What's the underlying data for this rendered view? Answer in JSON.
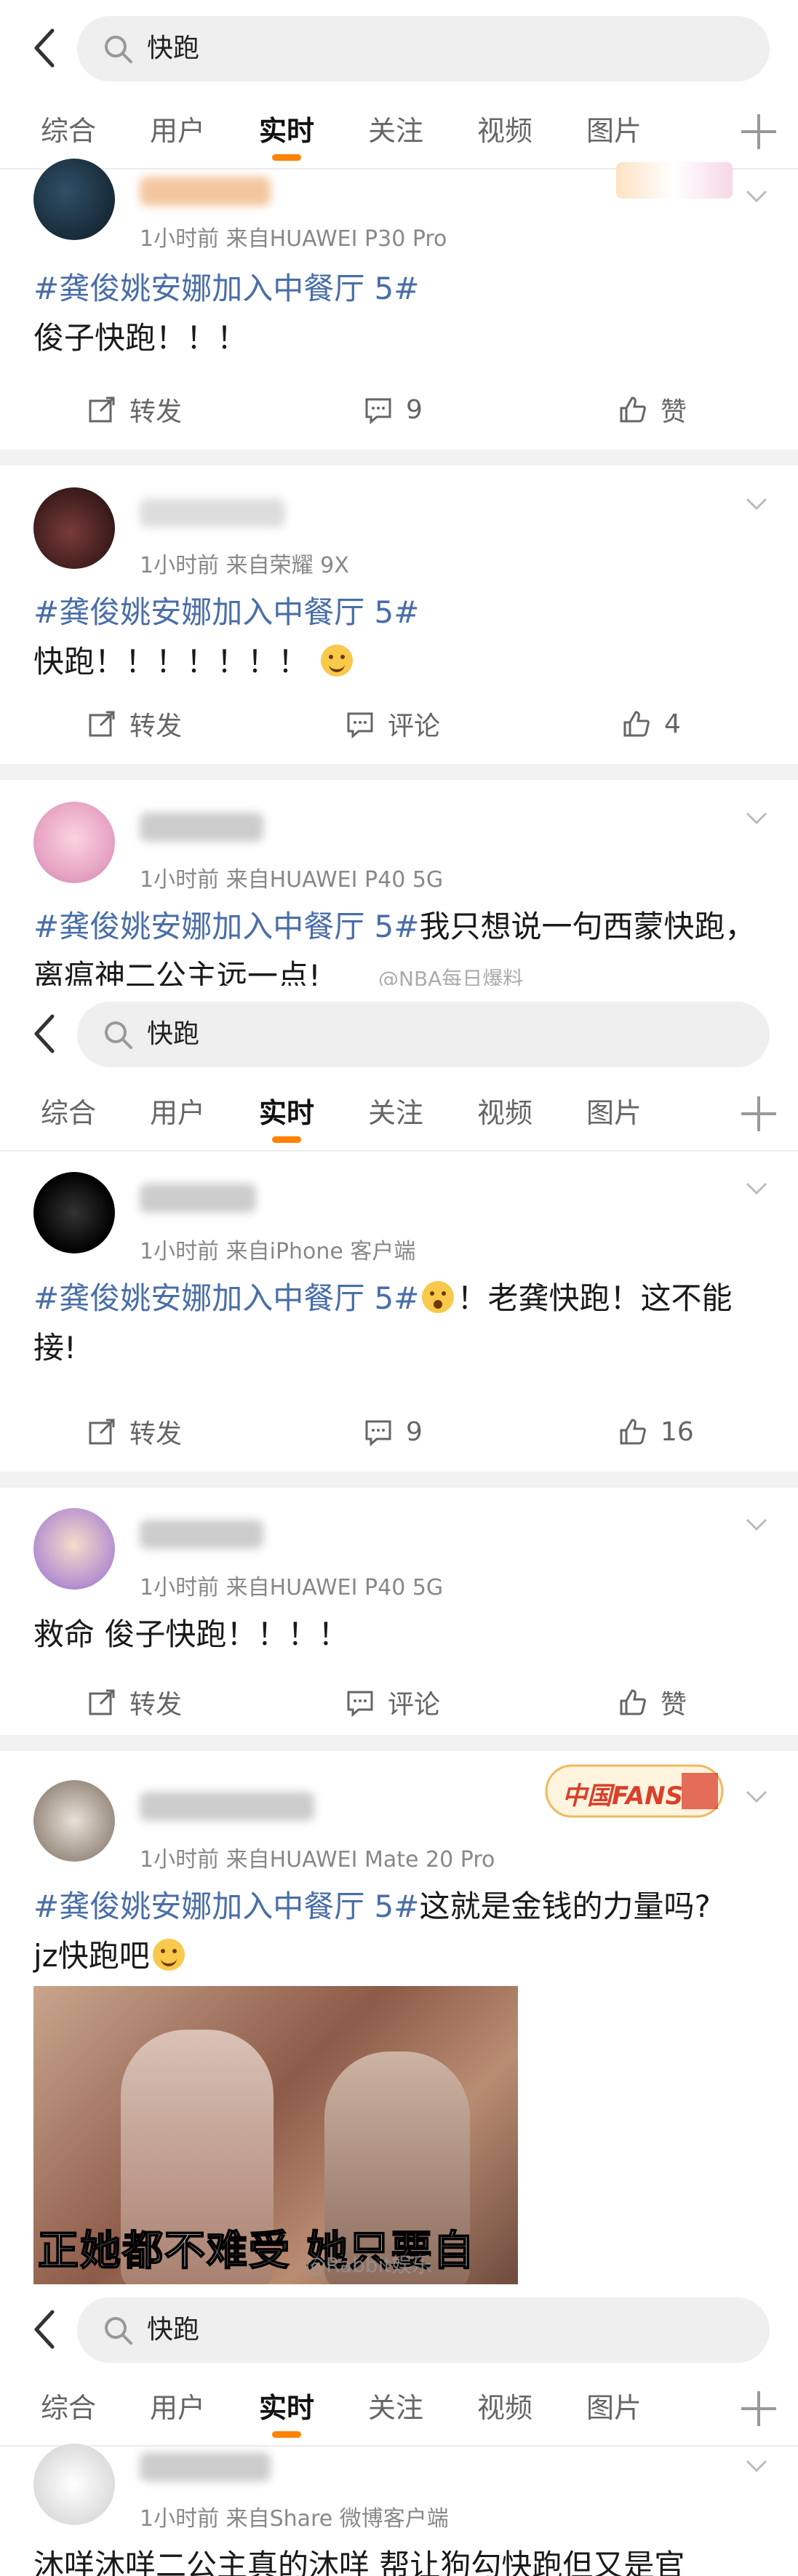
{
  "nav": {
    "query": "快跑",
    "tabs": [
      "综合",
      "用户",
      "实时",
      "关注",
      "视频",
      "图片"
    ],
    "active_tab": "实时"
  },
  "colors": {
    "accent": "#ff8200",
    "topic": "#4a6ea9",
    "meta": "#888888"
  },
  "screens": [
    {
      "posts": [
        {
          "meta": "1小时前  来自HUAWEI P30 Pro",
          "topic": "#龚俊姚安娜加入中餐厅 5#",
          "text": "俊子快跑！！！",
          "repost": "转发",
          "comment": "9",
          "like": "赞"
        },
        {
          "meta": "1小时前  来自荣耀 9X",
          "topic": "#龚俊姚安娜加入中餐厅 5#",
          "text": "快跑！！！！！！！",
          "repost": "转发",
          "comment": "评论",
          "like": "4"
        },
        {
          "meta": "1小时前  来自HUAWEI P40 5G",
          "topic": "#龚俊姚安娜加入中餐厅 5#",
          "text": "我只想说一句西蒙快跑，离瘟神二公主远一点!",
          "watermark": "@NBA每日爆料"
        }
      ]
    },
    {
      "posts": [
        {
          "meta": "1小时前  来自iPhone 客户端",
          "topic": "#龚俊姚安娜加入中餐厅 5#",
          "text_after_emoji": "！老龚快跑！这不能接!",
          "repost": "转发",
          "comment": "9",
          "like": "16"
        },
        {
          "meta": "1小时前  来自HUAWEI P40 5G",
          "text": "救命 俊子快跑！！！！",
          "repost": "转发",
          "comment": "评论",
          "like": "赞"
        },
        {
          "meta": "1小时前  来自HUAWEI Mate 20 Pro",
          "topic": "#龚俊姚安娜加入中餐厅 5#",
          "text": "这就是金钱的力量吗?",
          "text2": "jz快跑吧",
          "image_caption": "正她都不难受 她只要自",
          "watermark": "@Rabbit娱乐",
          "badge": "中国FANS"
        }
      ]
    },
    {
      "posts": [
        {
          "meta": "1小时前  来自Share 微博客户端",
          "text": "沐咩沐咩二公主真的沐咩  帮让狗勾快跑但又是官"
        }
      ]
    }
  ]
}
